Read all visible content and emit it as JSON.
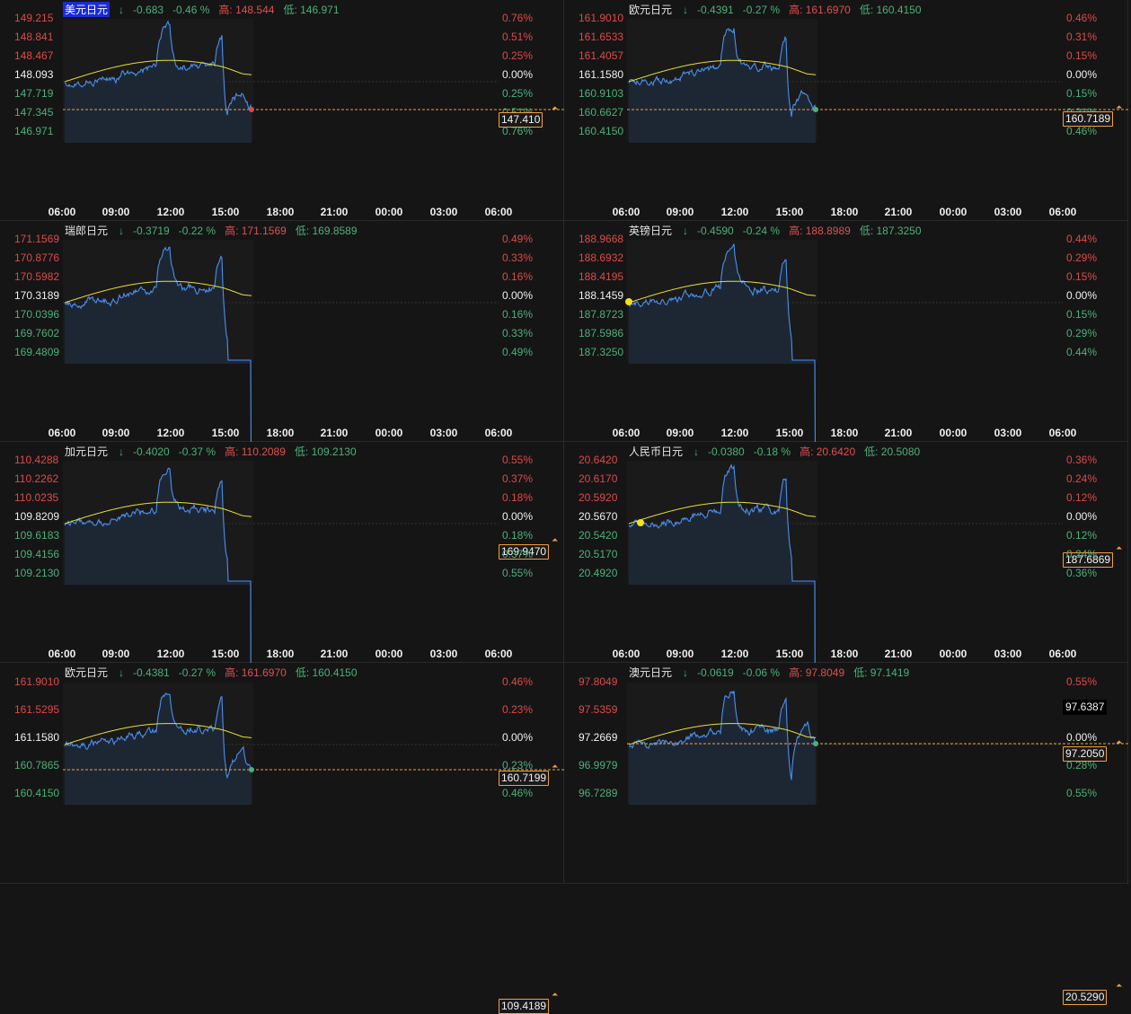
{
  "time_axis": [
    "06:00",
    "09:00",
    "12:00",
    "15:00",
    "18:00",
    "21:00",
    "00:00",
    "03:00",
    "06:00"
  ],
  "panels": [
    {
      "name": "美元日元",
      "arrow": "↓",
      "change": "-0.683",
      "percent": "-0.46 %",
      "high_label": "高: 148.544",
      "low_label": "低: 146.971",
      "selected": true,
      "y_labels": [
        "149.215",
        "148.841",
        "148.467",
        "148.093",
        "147.719",
        "147.345",
        "146.971"
      ],
      "pct_labels": [
        "0.76%",
        "0.51%",
        "0.25%",
        "0.00%",
        "0.25%",
        "0.51%",
        "0.76%"
      ],
      "current": "147.410",
      "end_dot_color": "#e04848",
      "cur_style": "normal"
    },
    {
      "name": "欧元日元",
      "arrow": "↓",
      "change": "-0.4391",
      "percent": "-0.27 %",
      "high_label": "高: 161.6970",
      "low_label": "低: 160.4150",
      "selected": false,
      "y_labels": [
        "161.9010",
        "161.6533",
        "161.4057",
        "161.1580",
        "160.9103",
        "160.6627",
        "160.4150"
      ],
      "pct_labels": [
        "0.46%",
        "0.31%",
        "0.15%",
        "0.00%",
        "0.15%",
        "0.31%",
        "0.46%"
      ],
      "current": "160.7189",
      "end_dot_color": "#4cb07a",
      "cur_style": "normal"
    },
    {
      "name": "瑞郎日元",
      "arrow": "↓",
      "change": "-0.3719",
      "percent": "-0.22 %",
      "high_label": "高: 171.1569",
      "low_label": "低: 169.8589",
      "selected": false,
      "y_labels": [
        "171.1569",
        "170.8776",
        "170.5982",
        "170.3189",
        "170.0396",
        "169.7602",
        "169.4809"
      ],
      "pct_labels": [
        "0.49%",
        "0.33%",
        "0.16%",
        "0.00%",
        "0.16%",
        "0.33%",
        "0.49%"
      ],
      "current": "169.9470",
      "end_dot_color": "#4cb07a",
      "cur_style": "normal"
    },
    {
      "name": "英镑日元",
      "arrow": "↓",
      "change": "-0.4590",
      "percent": "-0.24 %",
      "high_label": "高: 188.8989",
      "low_label": "低: 187.3250",
      "selected": false,
      "y_labels": [
        "188.9668",
        "188.6932",
        "188.4195",
        "188.1459",
        "187.8723",
        "187.5986",
        "187.3250"
      ],
      "pct_labels": [
        "0.44%",
        "0.29%",
        "0.15%",
        "0.00%",
        "0.15%",
        "0.29%",
        "0.44%"
      ],
      "current": "187.6869",
      "end_dot_color": "#4cb07a",
      "cur_style": "normal"
    },
    {
      "name": "加元日元",
      "arrow": "↓",
      "change": "-0.4020",
      "percent": "-0.37 %",
      "high_label": "高: 110.2089",
      "low_label": "低: 109.2130",
      "selected": false,
      "y_labels": [
        "110.4288",
        "110.2262",
        "110.0235",
        "109.8209",
        "109.6183",
        "109.4156",
        "109.2130"
      ],
      "pct_labels": [
        "0.55%",
        "0.37%",
        "0.18%",
        "0.00%",
        "0.18%",
        "0.37%",
        "0.55%"
      ],
      "current": "109.4189",
      "end_dot_color": "#4cb07a",
      "cur_style": "normal"
    },
    {
      "name": "人民币日元",
      "arrow": "↓",
      "change": "-0.0380",
      "percent": "-0.18 %",
      "high_label": "高: 20.6420",
      "low_label": "低: 20.5080",
      "selected": false,
      "y_labels": [
        "20.6420",
        "20.6170",
        "20.5920",
        "20.5670",
        "20.5420",
        "20.5170",
        "20.4920"
      ],
      "pct_labels": [
        "0.36%",
        "0.24%",
        "0.12%",
        "0.00%",
        "0.12%",
        "0.24%",
        "0.36%"
      ],
      "current": "20.5290",
      "end_dot_color": "#4cb07a",
      "cur_style": "normal"
    },
    {
      "name": "欧元日元",
      "arrow": "↓",
      "change": "-0.4381",
      "percent": "-0.27 %",
      "high_label": "高: 161.6970",
      "low_label": "低: 160.4150",
      "selected": false,
      "y_labels": [
        "161.9010",
        "161.5295",
        "161.1580",
        "160.7865",
        "160.4150"
      ],
      "pct_labels": [
        "0.46%",
        "0.23%",
        "0.00%",
        "0.23%",
        "0.46%"
      ],
      "current": "160.7199",
      "end_dot_color": "#4cb07a",
      "cur_style": "normal"
    },
    {
      "name": "澳元日元",
      "arrow": "↓",
      "change": "-0.0619",
      "percent": "-0.06 %",
      "high_label": "高: 97.8049",
      "low_label": "低: 97.1419",
      "selected": false,
      "y_labels": [
        "97.8049",
        "97.5359",
        "97.2669",
        "96.9979",
        "96.7289"
      ],
      "pct_labels": [
        "0.55%",
        "0.28%",
        "0.00%",
        "0.28%",
        "0.55%"
      ],
      "current": "97.2050",
      "extra_price": "97.6387",
      "end_dot_color": "#4cb07a",
      "cur_style": "normal"
    }
  ]
}
